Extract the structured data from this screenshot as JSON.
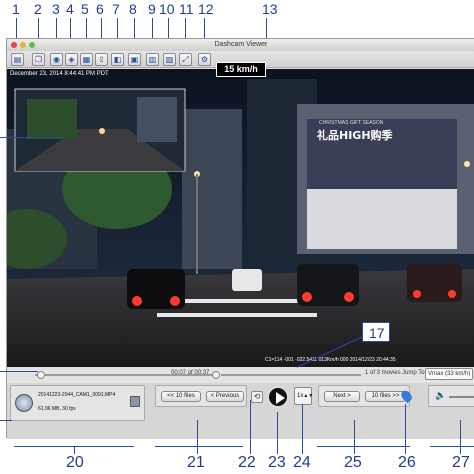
{
  "callouts": {
    "top": [
      "1",
      "2",
      "3",
      "4",
      "5",
      "6",
      "7",
      "8",
      "9",
      "10",
      "11",
      "12",
      "13"
    ],
    "bottom": [
      "20",
      "21",
      "22",
      "23",
      "24",
      "25",
      "26",
      "27"
    ],
    "mid": "17"
  },
  "window": {
    "title": "Dashcam Viewer"
  },
  "video": {
    "timestamp": "December 23, 2014 8:44:41 PM PDT",
    "speed": "15 km/h",
    "billboard": "礼品HIGH购季",
    "billboard_top": "CHRISTMAS GIFT SEASON",
    "gps_overlay": "C1=114 ·001 ·022.5411 013Km/h 000 2014/12/23 20:44:35"
  },
  "seek": {
    "time": "00:07 of 00:37",
    "movies": "1 of 3 movies",
    "jump_label": "Jump To:",
    "jump_value": "Vmax (33 km/h)"
  },
  "file_info": {
    "name": "20141223-2044_CAM1_0091.MP4",
    "details": "61.96 MB, 30 fps"
  },
  "buttons": {
    "prev10": "<< 10 files",
    "previous": "< Previous",
    "rate": "1x",
    "next": "Next >",
    "next10": "10 files >>"
  },
  "colors": {
    "callout": "#1f3c8f",
    "window_bg": "#dcdcdc"
  },
  "icons": {
    "toolbar": [
      "open-folder-icon",
      "copy-icon",
      "camera-icon",
      "map-icon",
      "chart-icon",
      "export-icon",
      "settings-icon",
      "trash-icon",
      "layout-icon",
      "save-icon",
      "print-icon",
      "fullscreen-icon",
      "gear-icon"
    ],
    "play": "play-icon",
    "loop": "loop-icon",
    "location": "location-pin-icon",
    "volume": "speaker-icon"
  }
}
